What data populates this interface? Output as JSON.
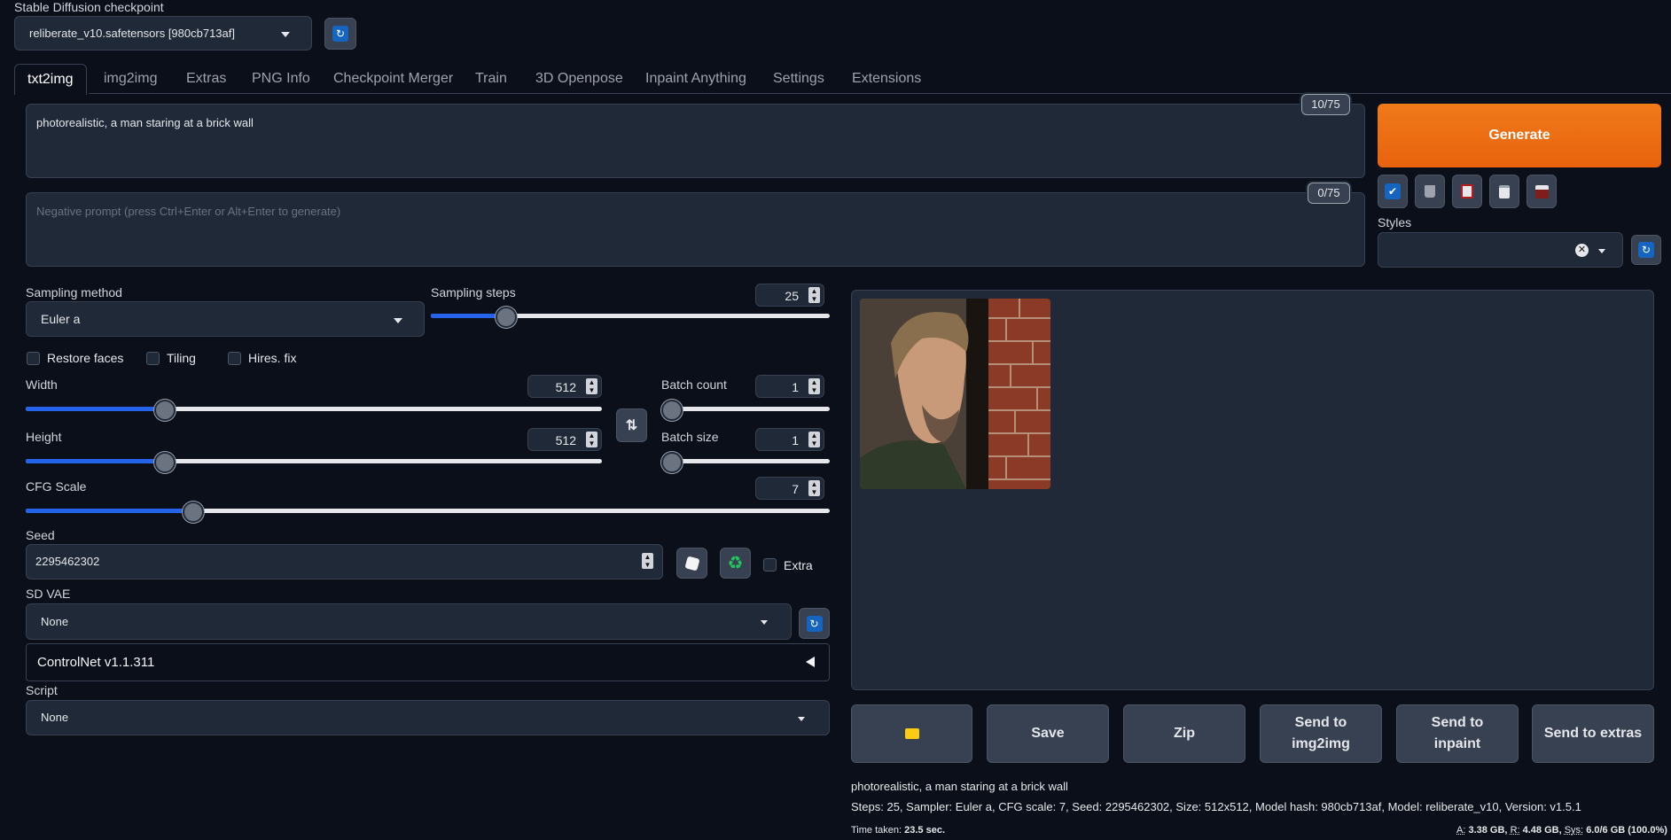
{
  "checkpoint": {
    "label": "Stable Diffusion checkpoint",
    "value": "reliberate_v10.safetensors [980cb713af]"
  },
  "tabs": [
    "txt2img",
    "img2img",
    "Extras",
    "PNG Info",
    "Checkpoint Merger",
    "Train",
    "3D Openpose",
    "Inpaint Anything",
    "Settings",
    "Extensions"
  ],
  "prompt": {
    "value": "photorealistic, a man staring at a brick wall",
    "counter": "10/75"
  },
  "negative_prompt": {
    "placeholder": "Negative prompt (press Ctrl+Enter or Alt+Enter to generate)",
    "counter": "0/75"
  },
  "generate_label": "Generate",
  "styles_label": "Styles",
  "sampling_method": {
    "label": "Sampling method",
    "value": "Euler a"
  },
  "sampling_steps": {
    "label": "Sampling steps",
    "value": "25"
  },
  "checkboxes": {
    "restore_faces": "Restore faces",
    "tiling": "Tiling",
    "hires_fix": "Hires. fix",
    "extra": "Extra"
  },
  "width": {
    "label": "Width",
    "value": "512"
  },
  "height": {
    "label": "Height",
    "value": "512"
  },
  "batch_count": {
    "label": "Batch count",
    "value": "1"
  },
  "batch_size": {
    "label": "Batch size",
    "value": "1"
  },
  "cfg_scale": {
    "label": "CFG Scale",
    "value": "7"
  },
  "seed": {
    "label": "Seed",
    "value": "2295462302"
  },
  "sd_vae": {
    "label": "SD VAE",
    "value": "None"
  },
  "controlnet": {
    "label": "ControlNet v1.1.311"
  },
  "script": {
    "label": "Script",
    "value": "None"
  },
  "output_buttons": {
    "save": "Save",
    "zip": "Zip",
    "send_img2img": "Send to img2img",
    "send_inpaint": "Send to inpaint",
    "send_extras": "Send to extras"
  },
  "info": {
    "prompt": "photorealistic, a man staring at a brick wall",
    "params": "Steps: 25, Sampler: Euler a, CFG scale: 7, Seed: 2295462302, Size: 512x512, Model hash: 980cb713af, Model: reliberate_v10, Version: v1.5.1",
    "time_label": "Time taken:",
    "time_value": "23.5 sec.",
    "mem_a_label": "A:",
    "mem_a": "3.38 GB,",
    "mem_r_label": "R:",
    "mem_r": "4.48 GB,",
    "mem_sys_label": "Sys:",
    "mem_sys": "6.0/6 GB (100.0%)"
  },
  "sliders": {
    "sampling_steps": 0.17,
    "width": 0.23,
    "height": 0.23,
    "batch_count": 0.0,
    "batch_size": 0.0,
    "cfg_scale": 0.2
  },
  "colors": {
    "generate": "#ea6a10",
    "accent": "#2563eb",
    "background": "#0b0f19"
  },
  "icons": [
    "refresh-icon",
    "swap-icon",
    "dice-icon",
    "recycle-icon",
    "folder-icon",
    "trash-icon",
    "clipboard-icon",
    "save-icon"
  ]
}
